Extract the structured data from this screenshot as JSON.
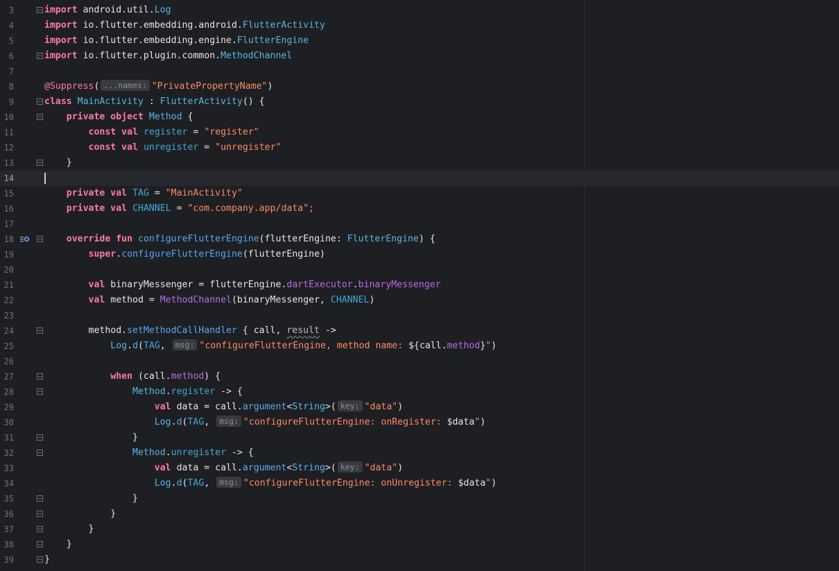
{
  "editor": {
    "current_line": "14",
    "lines": [
      {
        "n": "3",
        "tokens": [
          [
            "kw",
            "import"
          ],
          [
            "id",
            " android.util."
          ],
          [
            "cls",
            "Log"
          ]
        ]
      },
      {
        "n": "4",
        "tokens": [
          [
            "kw",
            "import"
          ],
          [
            "id",
            " io.flutter.embedding.android."
          ],
          [
            "cls",
            "FlutterActivity"
          ]
        ]
      },
      {
        "n": "5",
        "tokens": [
          [
            "kw",
            "import"
          ],
          [
            "id",
            " io.flutter.embedding.engine."
          ],
          [
            "cls",
            "FlutterEngine"
          ]
        ]
      },
      {
        "n": "6",
        "tokens": [
          [
            "kw",
            "import"
          ],
          [
            "id",
            " io.flutter.plugin.common."
          ],
          [
            "cls",
            "MethodChannel"
          ]
        ]
      },
      {
        "n": "7",
        "tokens": []
      },
      {
        "n": "8",
        "tokens": [
          [
            "ann",
            "@Suppress"
          ],
          [
            "id",
            "("
          ],
          [
            "hint",
            "...names:"
          ],
          [
            "str",
            "\"PrivatePropertyName\""
          ],
          [
            "id",
            ")"
          ]
        ]
      },
      {
        "n": "9",
        "tokens": [
          [
            "kw",
            "class"
          ],
          [
            "id",
            " "
          ],
          [
            "cls",
            "MainActivity"
          ],
          [
            "id",
            " : "
          ],
          [
            "cls",
            "FlutterActivity"
          ],
          [
            "id",
            "() {"
          ]
        ]
      },
      {
        "n": "10",
        "tokens": [
          [
            "id",
            "    "
          ],
          [
            "kw",
            "private object"
          ],
          [
            "id",
            " "
          ],
          [
            "cls",
            "Method"
          ],
          [
            "id",
            " {"
          ]
        ]
      },
      {
        "n": "11",
        "tokens": [
          [
            "id",
            "        "
          ],
          [
            "kw",
            "const val"
          ],
          [
            "id",
            " "
          ],
          [
            "cst",
            "register"
          ],
          [
            "id",
            " = "
          ],
          [
            "str",
            "\"register\""
          ]
        ]
      },
      {
        "n": "12",
        "tokens": [
          [
            "id",
            "        "
          ],
          [
            "kw",
            "const val"
          ],
          [
            "id",
            " "
          ],
          [
            "cst",
            "unregister"
          ],
          [
            "id",
            " = "
          ],
          [
            "str",
            "\"unregister\""
          ]
        ]
      },
      {
        "n": "13",
        "tokens": [
          [
            "id",
            "    }"
          ]
        ]
      },
      {
        "n": "14",
        "tokens": []
      },
      {
        "n": "15",
        "tokens": [
          [
            "id",
            "    "
          ],
          [
            "kw",
            "private val"
          ],
          [
            "id",
            " "
          ],
          [
            "cst",
            "TAG"
          ],
          [
            "id",
            " = "
          ],
          [
            "str",
            "\"MainActivity\""
          ]
        ]
      },
      {
        "n": "16",
        "tokens": [
          [
            "id",
            "    "
          ],
          [
            "kw",
            "private val"
          ],
          [
            "id",
            " "
          ],
          [
            "cst",
            "CHANNEL"
          ],
          [
            "id",
            " = "
          ],
          [
            "str",
            "\"com.company.app/data\";"
          ]
        ]
      },
      {
        "n": "17",
        "tokens": []
      },
      {
        "n": "18",
        "tokens": [
          [
            "id",
            "    "
          ],
          [
            "kw",
            "override fun"
          ],
          [
            "id",
            " "
          ],
          [
            "fn",
            "configureFlutterEngine"
          ],
          [
            "id",
            "(flutterEngine: "
          ],
          [
            "cls",
            "FlutterEngine"
          ],
          [
            "id",
            ") {"
          ]
        ]
      },
      {
        "n": "19",
        "tokens": [
          [
            "id",
            "        "
          ],
          [
            "kw",
            "super"
          ],
          [
            "id",
            "."
          ],
          [
            "fn",
            "configureFlutterEngine"
          ],
          [
            "id",
            "(flutterEngine)"
          ]
        ]
      },
      {
        "n": "20",
        "tokens": []
      },
      {
        "n": "21",
        "tokens": [
          [
            "id",
            "        "
          ],
          [
            "kw",
            "val"
          ],
          [
            "id",
            " binaryMessenger = flutterEngine."
          ],
          [
            "prop",
            "dartExecutor"
          ],
          [
            "id",
            "."
          ],
          [
            "prop",
            "binaryMessenger"
          ]
        ]
      },
      {
        "n": "22",
        "tokens": [
          [
            "id",
            "        "
          ],
          [
            "kw",
            "val"
          ],
          [
            "id",
            " method = "
          ],
          [
            "prop",
            "MethodChannel"
          ],
          [
            "id",
            "(binaryMessenger, "
          ],
          [
            "cst",
            "CHANNEL"
          ],
          [
            "id",
            ")"
          ]
        ]
      },
      {
        "n": "23",
        "tokens": []
      },
      {
        "n": "24",
        "tokens": [
          [
            "id",
            "        method."
          ],
          [
            "fn",
            "setMethodCallHandler"
          ],
          [
            "id",
            " { call, "
          ],
          [
            "wavy",
            "result"
          ],
          [
            "id",
            " ->"
          ]
        ]
      },
      {
        "n": "25",
        "tokens": [
          [
            "id",
            "            "
          ],
          [
            "cls",
            "Log"
          ],
          [
            "id",
            "."
          ],
          [
            "fn",
            "d"
          ],
          [
            "id",
            "("
          ],
          [
            "cst",
            "TAG"
          ],
          [
            "id",
            ", "
          ],
          [
            "hint",
            "msg:"
          ],
          [
            "str",
            "\"configureFlutterEngine, method name: "
          ],
          [
            "id",
            "${call."
          ],
          [
            "prop",
            "method"
          ],
          [
            "id",
            "}"
          ],
          [
            "str",
            "\""
          ],
          [
            "id",
            ")"
          ]
        ]
      },
      {
        "n": "26",
        "tokens": []
      },
      {
        "n": "27",
        "tokens": [
          [
            "id",
            "            "
          ],
          [
            "kw",
            "when"
          ],
          [
            "id",
            " (call."
          ],
          [
            "prop",
            "method"
          ],
          [
            "id",
            ") {"
          ]
        ]
      },
      {
        "n": "28",
        "tokens": [
          [
            "id",
            "                "
          ],
          [
            "cls",
            "Method"
          ],
          [
            "id",
            "."
          ],
          [
            "cst",
            "register"
          ],
          [
            "id",
            " -> {"
          ]
        ]
      },
      {
        "n": "29",
        "tokens": [
          [
            "id",
            "                    "
          ],
          [
            "kw",
            "val"
          ],
          [
            "id",
            " data = call."
          ],
          [
            "fn",
            "argument"
          ],
          [
            "id",
            "<"
          ],
          [
            "cls",
            "String"
          ],
          [
            "id",
            ">("
          ],
          [
            "hint",
            "key:"
          ],
          [
            "str",
            "\"data\""
          ],
          [
            "id",
            ")"
          ]
        ]
      },
      {
        "n": "30",
        "tokens": [
          [
            "id",
            "                    "
          ],
          [
            "cls",
            "Log"
          ],
          [
            "id",
            "."
          ],
          [
            "fn",
            "d"
          ],
          [
            "id",
            "("
          ],
          [
            "cst",
            "TAG"
          ],
          [
            "id",
            ", "
          ],
          [
            "hint",
            "msg:"
          ],
          [
            "str",
            "\"configureFlutterEngine: onRegister: "
          ],
          [
            "id",
            "$data"
          ],
          [
            "str",
            "\""
          ],
          [
            "id",
            ")"
          ]
        ]
      },
      {
        "n": "31",
        "tokens": [
          [
            "id",
            "                }"
          ]
        ]
      },
      {
        "n": "32",
        "tokens": [
          [
            "id",
            "                "
          ],
          [
            "cls",
            "Method"
          ],
          [
            "id",
            "."
          ],
          [
            "cst",
            "unregister"
          ],
          [
            "id",
            " -> {"
          ]
        ]
      },
      {
        "n": "33",
        "tokens": [
          [
            "id",
            "                    "
          ],
          [
            "kw",
            "val"
          ],
          [
            "id",
            " data = call."
          ],
          [
            "fn",
            "argument"
          ],
          [
            "id",
            "<"
          ],
          [
            "cls",
            "String"
          ],
          [
            "id",
            ">("
          ],
          [
            "hint",
            "key:"
          ],
          [
            "str",
            "\"data\""
          ],
          [
            "id",
            ")"
          ]
        ]
      },
      {
        "n": "34",
        "tokens": [
          [
            "id",
            "                    "
          ],
          [
            "cls",
            "Log"
          ],
          [
            "id",
            "."
          ],
          [
            "fn",
            "d"
          ],
          [
            "id",
            "("
          ],
          [
            "cst",
            "TAG"
          ],
          [
            "id",
            ", "
          ],
          [
            "hint",
            "msg:"
          ],
          [
            "str",
            "\"configureFlutterEngine: onUnregister: "
          ],
          [
            "id",
            "$data"
          ],
          [
            "str",
            "\""
          ],
          [
            "id",
            ")"
          ]
        ]
      },
      {
        "n": "35",
        "tokens": [
          [
            "id",
            "                }"
          ]
        ]
      },
      {
        "n": "36",
        "tokens": [
          [
            "id",
            "            }"
          ]
        ]
      },
      {
        "n": "37",
        "tokens": [
          [
            "id",
            "        }"
          ]
        ]
      },
      {
        "n": "38",
        "tokens": [
          [
            "id",
            "    }"
          ]
        ]
      },
      {
        "n": "39",
        "tokens": [
          [
            "id",
            "}"
          ]
        ]
      }
    ],
    "fold_lines": [
      "3",
      "6",
      "9",
      "10",
      "13",
      "18",
      "24",
      "27",
      "28",
      "31",
      "32",
      "35",
      "36",
      "37",
      "38",
      "39"
    ],
    "fold_open_lines": [
      "3",
      "9",
      "10",
      "18",
      "24",
      "27",
      "28",
      "32"
    ],
    "gutter_icon_lines": [
      "18"
    ],
    "gutter_icon_name": "override-method-icon"
  },
  "colors": {
    "background": "#1e1f22",
    "keyword": "#ff79a8",
    "class": "#56b6e8",
    "function": "#56a8f5",
    "property": "#b96be8",
    "string": "#ff8a65"
  }
}
